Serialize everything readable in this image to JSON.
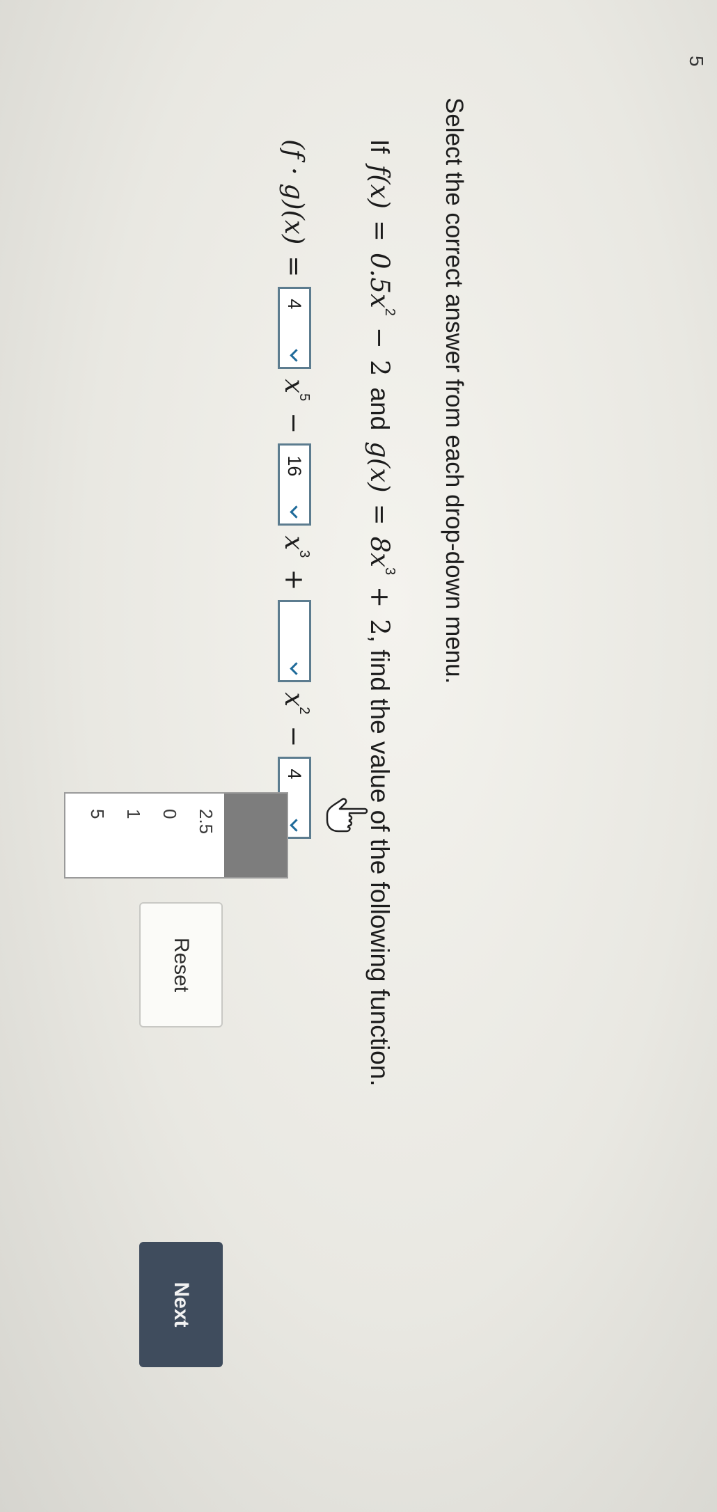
{
  "question": {
    "number": "5",
    "instruction": "Select the correct answer from each drop-down menu.",
    "prompt": {
      "if": "If",
      "f_lhs": "f(x)",
      "eq": "=",
      "f_coef": "0.5x",
      "f_exp": "2",
      "minus": "−",
      "f_const": "2",
      "and": "and",
      "g_lhs": "g(x)",
      "g_coef": "8x",
      "g_exp": "3",
      "plus": "+",
      "g_const": "2",
      "rest": ", find the value of the following function."
    },
    "equation": {
      "lhs": "(f · g)(x)",
      "eq": "=",
      "x5_var": "x",
      "x5_exp": "5",
      "x3_var": "x",
      "x3_exp": "3",
      "x2_var": "x",
      "x2_exp": "2",
      "minus": "−",
      "plus": "+"
    }
  },
  "dropdowns": [
    {
      "id": "coef-x5",
      "selected": "4"
    },
    {
      "id": "coef-x3",
      "selected": "16"
    },
    {
      "id": "coef-x2",
      "selected": "",
      "open": true,
      "options": [
        "2.5",
        "0",
        "1",
        "5"
      ]
    },
    {
      "id": "constant",
      "selected": "4"
    }
  ],
  "buttons": {
    "reset": "Reset",
    "next": "Next"
  },
  "colors": {
    "next_bg": "#3f4c5d",
    "select_border": "#5c7c8f",
    "chevron": "#1f6b9a"
  },
  "icons": {
    "cursor": "hand-pointer-icon",
    "chevron": "chevron-down-icon"
  }
}
